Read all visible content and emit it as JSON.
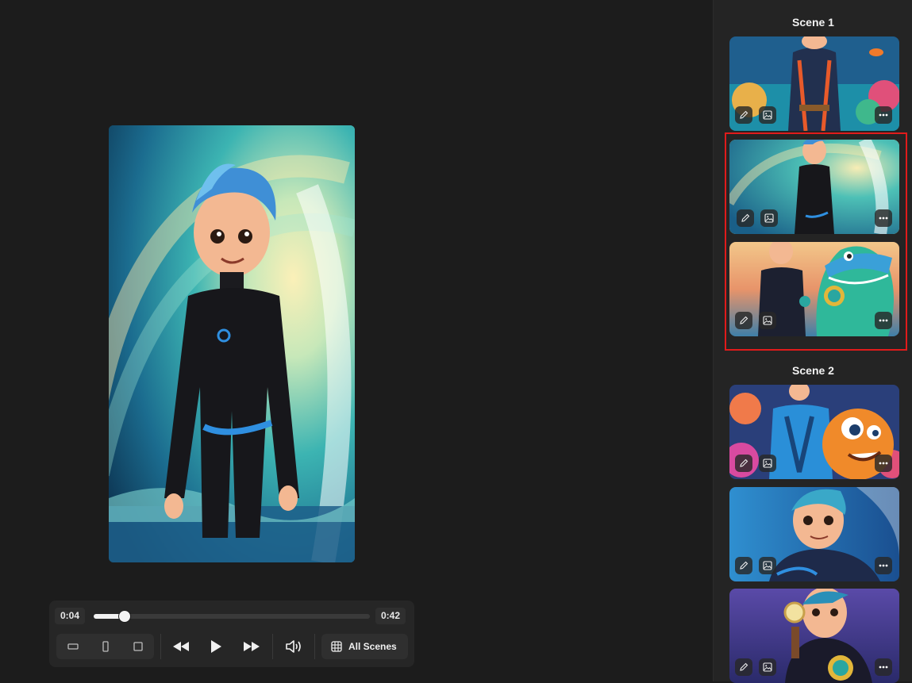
{
  "player": {
    "current_time": "0:04",
    "total_time": "0:42",
    "progress": 0.11,
    "all_scenes_label": "All Scenes",
    "ratio_options": [
      "landscape",
      "portrait",
      "square"
    ]
  },
  "sidebar": {
    "scenes": [
      {
        "title": "Scene 1",
        "thumbnails": [
          {
            "selected": false,
            "theme": "coral-reef-diver"
          },
          {
            "selected": true,
            "theme": "wave-surfer"
          },
          {
            "selected": false,
            "theme": "diver-with-shark-friend"
          }
        ]
      },
      {
        "title": "Scene 2",
        "thumbnails": [
          {
            "selected": false,
            "theme": "diver-with-clownfish"
          },
          {
            "selected": false,
            "theme": "boy-closeup-ocean"
          },
          {
            "selected": false,
            "theme": "diver-with-compass"
          }
        ]
      }
    ]
  },
  "colors": {
    "selected_outline": "#d7ef7a",
    "highlight_box": "#e01b1b",
    "background": "#1c1c1c"
  },
  "icons": [
    "landscape-ratio-icon",
    "portrait-ratio-icon",
    "square-ratio-icon",
    "rewind-icon",
    "play-icon",
    "fast-forward-icon",
    "volume-icon",
    "grid-icon",
    "pencil-icon",
    "image-icon",
    "more-icon"
  ]
}
